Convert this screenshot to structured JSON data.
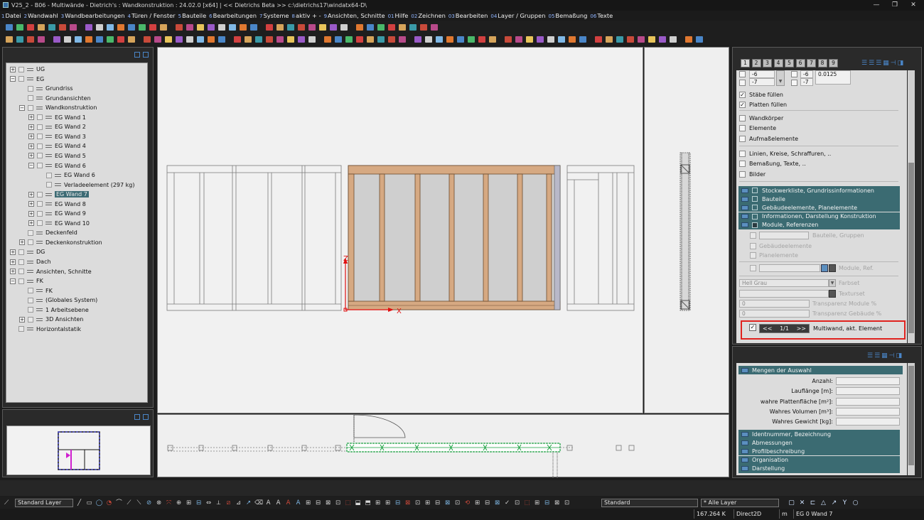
{
  "title_bar": {
    "text": "V25_2 - B06 - Multiwände - Dietrich's : Wandkonstruktion : 24.02.0 [x64] |        << Dietrichs Beta >> c:\\dietrichs17\\windatx64-D\\",
    "minimize": "—",
    "maximize": "❐",
    "close": "✕"
  },
  "menu": [
    {
      "num": "1",
      "label": "Datei"
    },
    {
      "num": "2",
      "label": "Wandwahl"
    },
    {
      "num": "3",
      "label": "Wandbearbeitungen"
    },
    {
      "num": "4",
      "label": "Türen / Fenster"
    },
    {
      "num": "5",
      "label": "Bauteile"
    },
    {
      "num": "6",
      "label": "Bearbeitungen"
    },
    {
      "num": "7",
      "label": "Systeme"
    },
    {
      "num": "8",
      "label": "aktiv + -"
    },
    {
      "num": "9",
      "label": "Ansichten, Schnitte"
    },
    {
      "num": "01",
      "label": "Hilfe"
    },
    {
      "num": "02",
      "label": "Zeichnen"
    },
    {
      "num": "03",
      "label": "Bearbeiten"
    },
    {
      "num": "04",
      "label": "Layer / Gruppen"
    },
    {
      "num": "05",
      "label": "Bemaßung"
    },
    {
      "num": "06",
      "label": "Texte"
    }
  ],
  "tree": [
    {
      "indent": 0,
      "exp": "+",
      "label": "UG",
      "selected": false
    },
    {
      "indent": 0,
      "exp": "−",
      "label": "EG",
      "selected": false
    },
    {
      "indent": 1,
      "exp": "",
      "label": "Grundriss",
      "selected": false
    },
    {
      "indent": 1,
      "exp": "",
      "label": "Grundansichten",
      "selected": false
    },
    {
      "indent": 1,
      "exp": "−",
      "label": "Wandkonstruktion",
      "selected": false
    },
    {
      "indent": 2,
      "exp": "+",
      "label": "EG Wand 1",
      "selected": false
    },
    {
      "indent": 2,
      "exp": "+",
      "label": "EG Wand 2",
      "selected": false
    },
    {
      "indent": 2,
      "exp": "+",
      "label": "EG Wand 3",
      "selected": false
    },
    {
      "indent": 2,
      "exp": "+",
      "label": "EG Wand 4",
      "selected": false
    },
    {
      "indent": 2,
      "exp": "+",
      "label": "EG Wand 5",
      "selected": false
    },
    {
      "indent": 2,
      "exp": "−",
      "label": "EG Wand 6",
      "selected": false
    },
    {
      "indent": 3,
      "exp": "",
      "label": "EG Wand 6",
      "selected": false
    },
    {
      "indent": 3,
      "exp": "",
      "label": "Verladeelement  (297 kg)",
      "selected": false
    },
    {
      "indent": 2,
      "exp": "+",
      "label": "EG Wand 7",
      "selected": true
    },
    {
      "indent": 2,
      "exp": "+",
      "label": "EG Wand 8",
      "selected": false
    },
    {
      "indent": 2,
      "exp": "+",
      "label": "EG Wand 9",
      "selected": false
    },
    {
      "indent": 2,
      "exp": "+",
      "label": "EG Wand 10",
      "selected": false
    },
    {
      "indent": 1,
      "exp": "",
      "label": "Deckenfeld",
      "selected": false
    },
    {
      "indent": 1,
      "exp": "+",
      "label": "Deckenkonstruktion",
      "selected": false
    },
    {
      "indent": 0,
      "exp": "+",
      "label": "DG",
      "selected": false
    },
    {
      "indent": 0,
      "exp": "+",
      "label": "Dach",
      "selected": false
    },
    {
      "indent": 0,
      "exp": "+",
      "label": "Ansichten, Schnitte",
      "selected": false
    },
    {
      "indent": 0,
      "exp": "−",
      "label": "FK",
      "selected": false
    },
    {
      "indent": 1,
      "exp": "",
      "label": "FK",
      "selected": false
    },
    {
      "indent": 1,
      "exp": "",
      "label": "(Globales System)",
      "selected": false
    },
    {
      "indent": 1,
      "exp": "",
      "label": "1 Arbeitsebene",
      "selected": false
    },
    {
      "indent": 1,
      "exp": "+",
      "label": "3D Ansichten",
      "selected": false
    },
    {
      "indent": 0,
      "exp": "",
      "label": "Horizontalstatik",
      "selected": false
    }
  ],
  "viewport": {
    "axis_z": "Z",
    "axis_x": "X"
  },
  "right_panel": {
    "tabs": [
      "1",
      "2",
      "3",
      "4",
      "5",
      "6",
      "7",
      "8",
      "9"
    ],
    "values": {
      "a1": "-6",
      "a2": "-7",
      "b1": "-6",
      "b2": "-7",
      "c": "0.0125"
    },
    "checks": [
      {
        "label": "Stäbe füllen",
        "checked": true
      },
      {
        "label": "Platten füllen",
        "checked": true
      }
    ],
    "options_a": [
      "Wandkörper",
      "Elemente",
      "Aufmaßelemente"
    ],
    "options_b": [
      "Linien, Kreise, Schraffuren, ..",
      "Bemaßung, Texte, ..",
      "Bilder"
    ],
    "teal_rows": [
      "Stockwerkliste, Grundrissinformationen",
      "Bauteile",
      "Gebäudeelemente, Planelemente",
      "Informationen, Darstellung Konstruktion",
      "Module, Referenzen"
    ],
    "disabled": {
      "bauteile_gruppen": "Bauteile, Gruppen",
      "gebaeudeelemente": "Gebäudeelemente",
      "planelemente": "Planelemente",
      "module_ref": "Module, Ref.",
      "farbset_value": "Hell Grau",
      "farbset": "Farbset",
      "texturset": "Texturset",
      "transp_module_value": "0",
      "transp_module": "Transparenz Module %",
      "transp_gebaeude_value": "0",
      "transp_gebaeude": "Transparenz Gebäude %"
    },
    "nav": {
      "prev": "<<",
      "page": "1/1",
      "next": ">>",
      "label": "Multiwand, akt. Element"
    }
  },
  "quantities": {
    "header": "Mengen der Auswahl",
    "fields": [
      "Anzahl:",
      "Lauflänge [m]:",
      "wahre Plattenfläche [m²]:",
      "Wahres Volumen [m³]:",
      "Wahres Gewicht [kg]:"
    ],
    "sections": [
      "Identnummer, Bezeichnung",
      "Abmessungen",
      "Profilbeschreibung",
      "Organisation",
      "Darstellung"
    ]
  },
  "bottom_toolbar": {
    "layer_dropdown": "Standard Layer",
    "style_dropdown": "Standard",
    "layers_dropdown": "* Alle Layer"
  },
  "status": {
    "memory": "167.264 K",
    "renderer": "Direct2D",
    "unit": "m",
    "element": "EG 0 Wand 7"
  },
  "colors": {
    "teal": "#3b6b72",
    "highlight_box": "#e0231f",
    "timber": "#d6a982",
    "panel_grey": "#dcdcdc"
  }
}
